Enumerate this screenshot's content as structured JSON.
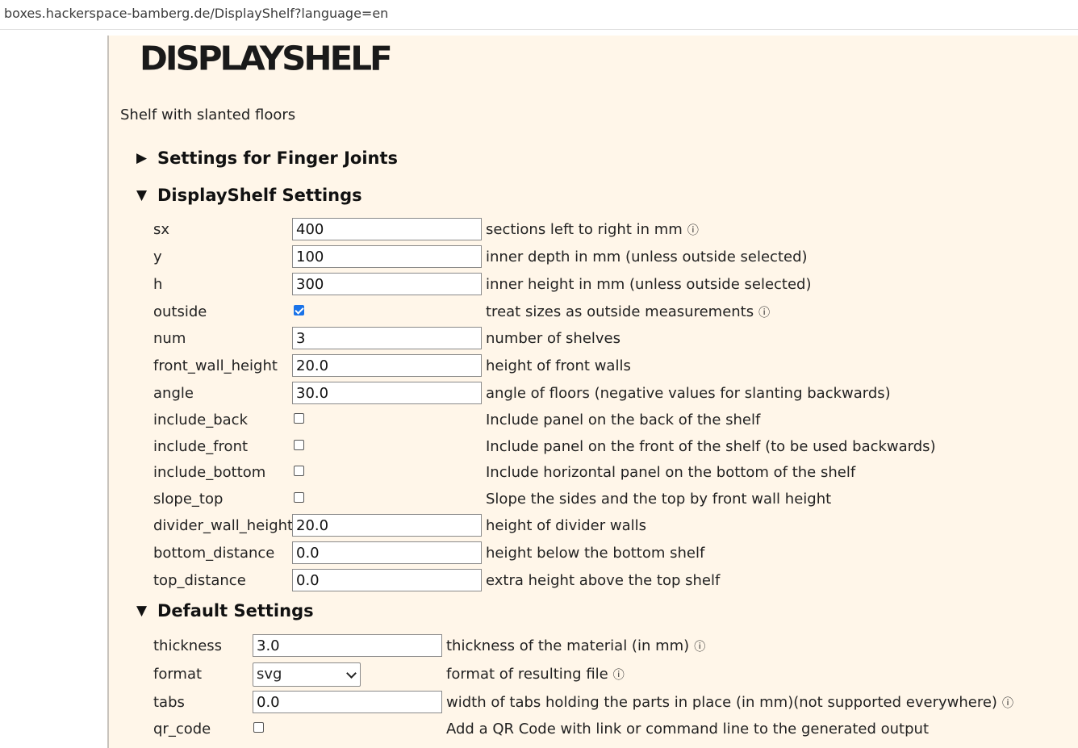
{
  "browser": {
    "url": "boxes.hackerspace-bamberg.de/DisplayShelf?language=en"
  },
  "page": {
    "title": "DISPLAYSHELF",
    "description": "Shelf with slanted floors",
    "sections": [
      {
        "label": "Settings for Finger Joints",
        "expanded": false
      },
      {
        "label": "DisplayShelf Settings",
        "expanded": true
      },
      {
        "label": "Default Settings",
        "expanded": true
      }
    ],
    "display_shelf": [
      {
        "name": "sx",
        "type": "text",
        "value": "400",
        "help": "sections left to right in mm",
        "info": true
      },
      {
        "name": "y",
        "type": "text",
        "value": "100",
        "help": "inner depth in mm (unless outside selected)",
        "info": false
      },
      {
        "name": "h",
        "type": "text",
        "value": "300",
        "help": "inner height in mm (unless outside selected)",
        "info": false
      },
      {
        "name": "outside",
        "type": "checkbox",
        "checked": true,
        "help": "treat sizes as outside measurements",
        "info": true
      },
      {
        "name": "num",
        "type": "text",
        "value": "3",
        "help": "number of shelves",
        "info": false
      },
      {
        "name": "front_wall_height",
        "type": "text",
        "value": "20.0",
        "help": "height of front walls",
        "info": false
      },
      {
        "name": "angle",
        "type": "text",
        "value": "30.0",
        "help": "angle of floors (negative values for slanting backwards)",
        "info": false
      },
      {
        "name": "include_back",
        "type": "checkbox",
        "checked": false,
        "help": "Include panel on the back of the shelf",
        "info": false
      },
      {
        "name": "include_front",
        "type": "checkbox",
        "checked": false,
        "help": "Include panel on the front of the shelf (to be used backwards)",
        "info": false
      },
      {
        "name": "include_bottom",
        "type": "checkbox",
        "checked": false,
        "help": "Include horizontal panel on the bottom of the shelf",
        "info": false
      },
      {
        "name": "slope_top",
        "type": "checkbox",
        "checked": false,
        "help": "Slope the sides and the top by front wall height",
        "info": false
      },
      {
        "name": "divider_wall_height",
        "type": "text",
        "value": "20.0",
        "help": "height of divider walls",
        "info": false
      },
      {
        "name": "bottom_distance",
        "type": "text",
        "value": "0.0",
        "help": "height below the bottom shelf",
        "info": false
      },
      {
        "name": "top_distance",
        "type": "text",
        "value": "0.0",
        "help": "extra height above the top shelf",
        "info": false
      }
    ],
    "default_settings": [
      {
        "name": "thickness",
        "type": "text",
        "value": "3.0",
        "help": "thickness of the material (in mm)",
        "info": true
      },
      {
        "name": "format",
        "type": "select",
        "value": "svg",
        "help": "format of resulting file",
        "info": true
      },
      {
        "name": "tabs",
        "type": "text",
        "value": "0.0",
        "help": "width of tabs holding the parts in place (in mm)(not supported everywhere)",
        "info": true
      },
      {
        "name": "qr_code",
        "type": "checkbox",
        "checked": false,
        "help": "Add a QR Code with link or command line to the generated output",
        "info": false
      }
    ],
    "icons": {
      "collapsed": "triangle-right-icon",
      "expanded": "triangle-down-icon",
      "info": "info-icon"
    },
    "glyphs": {
      "collapsed": "▶",
      "expanded": "▼",
      "info": "ⓘ"
    }
  }
}
